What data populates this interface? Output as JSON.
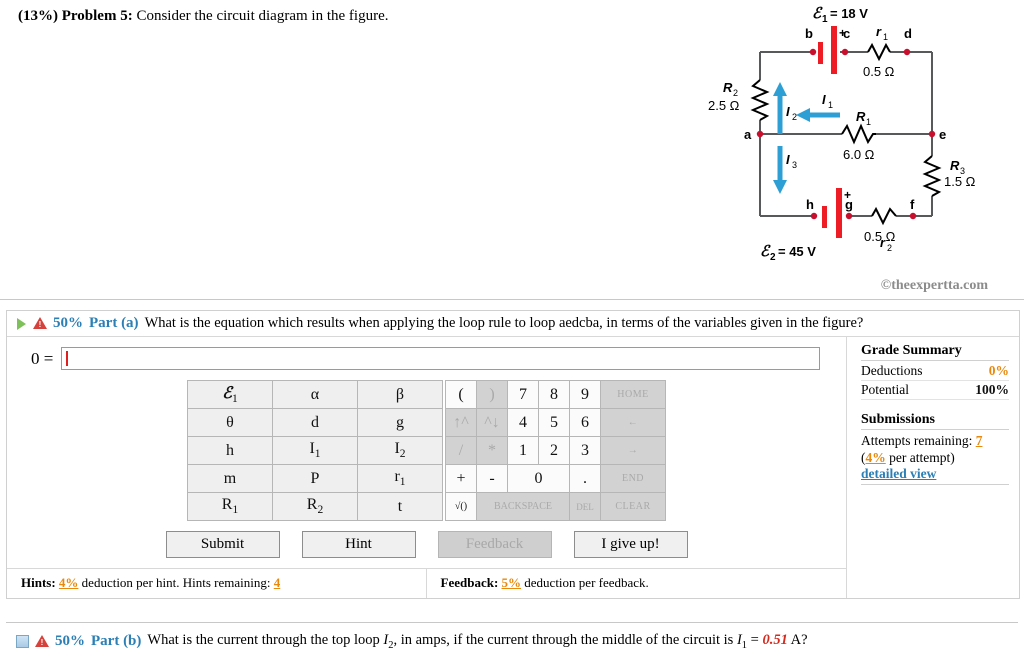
{
  "problem": {
    "percent": "(13%)",
    "label": "Problem 5:",
    "statement": "Consider the circuit diagram in the figure."
  },
  "figure": {
    "emf1_label": "ℰ",
    "emf1_sub": "1",
    "emf1_value": "= 18 V",
    "emf2_label": "ℰ",
    "emf2_sub": "2",
    "emf2_value": "= 45 V",
    "nodes": {
      "a": "a",
      "b": "b",
      "c": "c",
      "d": "d",
      "e": "e",
      "f": "f",
      "g": "g",
      "h": "h"
    },
    "r1_name": "r",
    "r1_sub": "1",
    "r1_value": "0.5 Ω",
    "r2_name": "r",
    "r2_sub": "2",
    "r2_value": "0.5 Ω",
    "R1_name": "R",
    "R1_sub": "1",
    "R1_value": "6.0 Ω",
    "R2_name": "R",
    "R2_sub": "2",
    "R2_value": "2.5 Ω",
    "R3_name": "R",
    "R3_sub": "3",
    "R3_value": "1.5 Ω",
    "I1_name": "I",
    "I1_sub": "1",
    "I2_name": "I",
    "I2_sub": "2",
    "I3_name": "I",
    "I3_sub": "3",
    "plus_sign": "+",
    "watermark": "©theexpertta.com",
    "wire_color": "#58595b",
    "battery_color": "#ee1c25",
    "current_color": "#2e9fd4",
    "node_color": "#c8102e"
  },
  "part_a": {
    "percent": "50%",
    "label": "Part (a)",
    "question": "What is the equation which results when applying the loop rule to loop aedcba, in terms of the variables given in the figure?",
    "answer_prefix": "0 =",
    "answer_value": "",
    "play_icon": "play-icon",
    "warning_icon": "warning-icon"
  },
  "keypad": {
    "variables": [
      [
        {
          "label": "ℰ",
          "sub": "1",
          "script": true
        },
        {
          "label": "α"
        },
        {
          "label": "β"
        }
      ],
      [
        {
          "label": "θ"
        },
        {
          "label": "d"
        },
        {
          "label": "g"
        }
      ],
      [
        {
          "label": "h"
        },
        {
          "label": "I",
          "sub": "1"
        },
        {
          "label": "I",
          "sub": "2"
        }
      ],
      [
        {
          "label": "m"
        },
        {
          "label": "P"
        },
        {
          "label": "r",
          "sub": "1"
        }
      ],
      [
        {
          "label": "R",
          "sub": "1"
        },
        {
          "label": "R",
          "sub": "2"
        },
        {
          "label": "t"
        }
      ]
    ],
    "numeric": [
      [
        {
          "label": "(",
          "enabled": true,
          "kind": "op"
        },
        {
          "label": ")",
          "enabled": false,
          "kind": "op"
        },
        {
          "label": "7",
          "enabled": true,
          "kind": "num"
        },
        {
          "label": "8",
          "enabled": true,
          "kind": "num"
        },
        {
          "label": "9",
          "enabled": true,
          "kind": "num"
        },
        {
          "label": "HOME",
          "enabled": false,
          "kind": "cmd"
        }
      ],
      [
        {
          "label": "↑^",
          "enabled": false,
          "kind": "op"
        },
        {
          "label": "^↓",
          "enabled": false,
          "kind": "op"
        },
        {
          "label": "4",
          "enabled": true,
          "kind": "num"
        },
        {
          "label": "5",
          "enabled": true,
          "kind": "num"
        },
        {
          "label": "6",
          "enabled": true,
          "kind": "num"
        },
        {
          "label": "←",
          "enabled": false,
          "kind": "cmd"
        }
      ],
      [
        {
          "label": "/",
          "enabled": false,
          "kind": "op"
        },
        {
          "label": "*",
          "enabled": false,
          "kind": "op"
        },
        {
          "label": "1",
          "enabled": true,
          "kind": "num"
        },
        {
          "label": "2",
          "enabled": true,
          "kind": "num"
        },
        {
          "label": "3",
          "enabled": true,
          "kind": "num"
        },
        {
          "label": "→",
          "enabled": false,
          "kind": "cmd"
        }
      ],
      [
        {
          "label": "+",
          "enabled": true,
          "kind": "op"
        },
        {
          "label": "-",
          "enabled": true,
          "kind": "op"
        },
        {
          "label": "0",
          "enabled": true,
          "kind": "num",
          "colspan": 2
        },
        {
          "label": ".",
          "enabled": true,
          "kind": "num"
        },
        {
          "label": "END",
          "enabled": false,
          "kind": "cmd"
        }
      ],
      [
        {
          "label": "√()",
          "enabled": true,
          "kind": "op"
        },
        {
          "label": "BACKSPACE",
          "enabled": false,
          "kind": "num",
          "colspan": 3
        },
        {
          "label": "DEL",
          "enabled": false,
          "kind": "num",
          "small": true
        },
        {
          "label": "CLEAR",
          "enabled": false,
          "kind": "cmd"
        }
      ]
    ]
  },
  "buttons": {
    "submit": "Submit",
    "hint": "Hint",
    "feedback": "Feedback",
    "give_up": "I give up!"
  },
  "hints_footer": {
    "hints_label": "Hints:",
    "hints_pct": "4%",
    "hints_text": "deduction per hint. Hints remaining:",
    "hints_remaining": "4",
    "feedback_label": "Feedback:",
    "feedback_pct": "5%",
    "feedback_text": "deduction per feedback."
  },
  "grade_summary": {
    "title": "Grade Summary",
    "deductions_label": "Deductions",
    "deductions_value": "0%",
    "potential_label": "Potential",
    "potential_value": "100%",
    "submissions_title": "Submissions",
    "attempts_label": "Attempts remaining:",
    "attempts_value": "7",
    "per_attempt_open": "(",
    "per_attempt_pct": "4%",
    "per_attempt_text": "per attempt)",
    "detailed_view": "detailed view"
  },
  "part_b": {
    "percent": "50%",
    "label": "Part (b)",
    "q1": "What is the current through the top loop",
    "i2": "I",
    "i2_sub": "2",
    "q2": ", in amps, if the current through the middle of the circuit is",
    "i1": "I",
    "i1_sub": "1",
    "eq": "=",
    "value": "0.51",
    "unit": "A?",
    "square_icon": "square-icon",
    "warning_icon": "warning-icon"
  }
}
